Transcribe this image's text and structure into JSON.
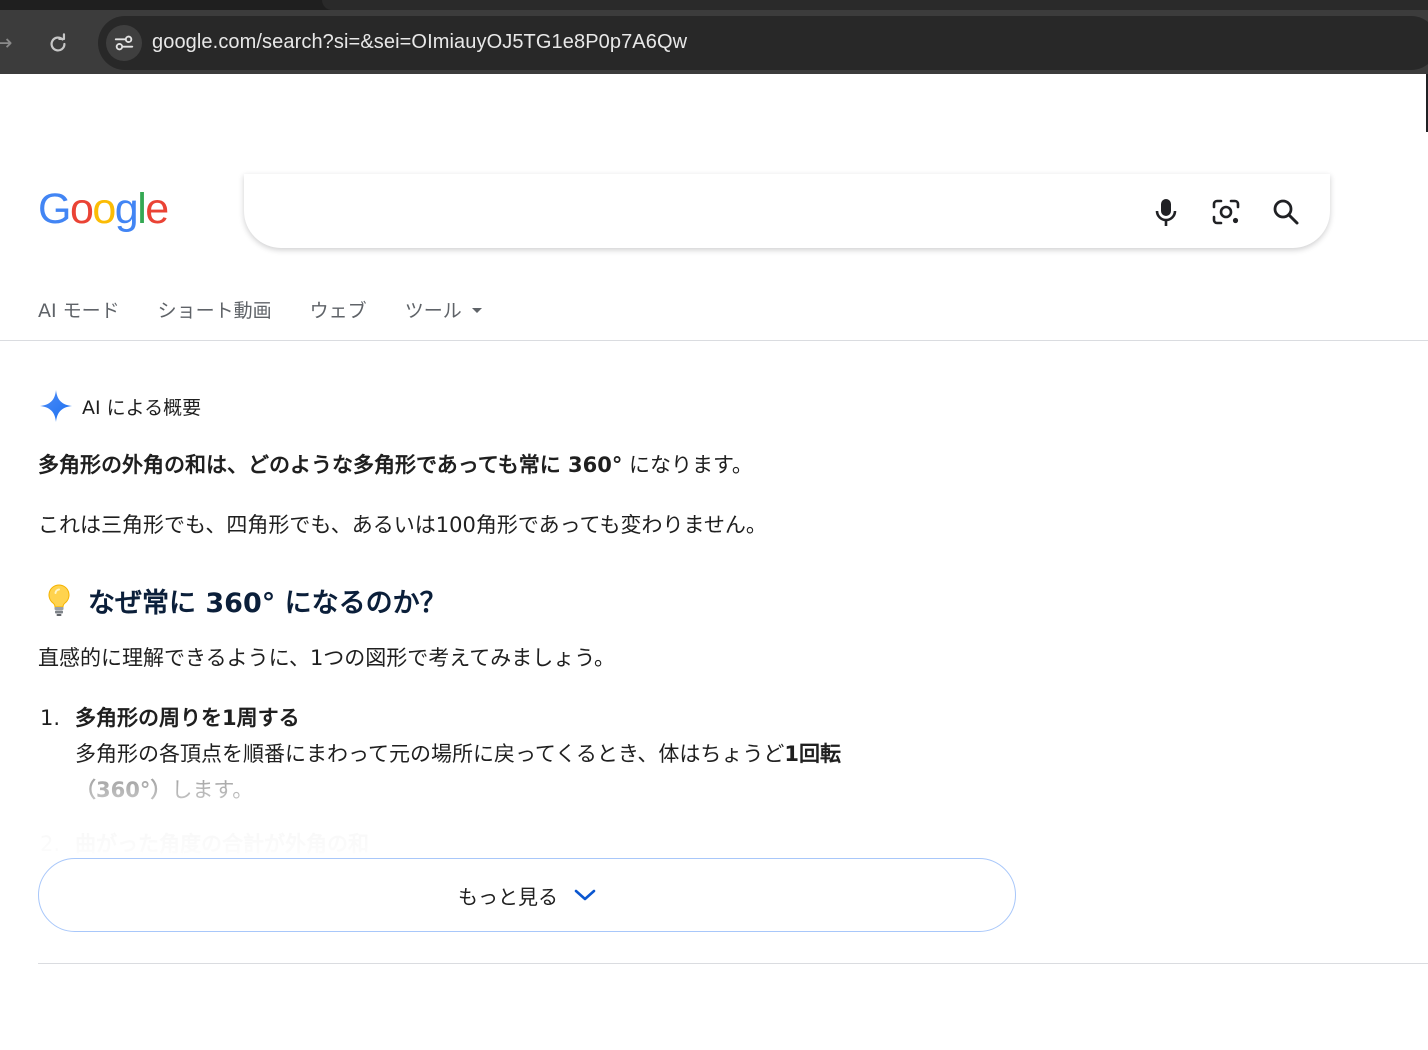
{
  "browser": {
    "url": "google.com/search?si=&sei=OImiauyOJ5TG1e8P0p7A6Qw"
  },
  "logo": {
    "letters": [
      "G",
      "o",
      "o",
      "g",
      "l",
      "e"
    ],
    "colors": [
      "#4285F4",
      "#EA4335",
      "#FBBC05",
      "#4285F4",
      "#34A853",
      "#EA4335"
    ]
  },
  "search": {
    "value": "",
    "icons": [
      "mic-icon",
      "lens-icon",
      "search-icon"
    ]
  },
  "tabs": [
    "AI モード",
    "ショート動画",
    "ウェブ",
    "ツール"
  ],
  "ai_overview": {
    "label": "AI による概要",
    "lead_bold": "多角形の外角の和は、どのような多角形であっても常に 360°",
    "lead_rest": " になります。",
    "para2": "これは三角形でも、四角形でも、あるいは100角形であっても変わりません。",
    "heading": "なぜ常に 360° になるのか？",
    "para3": "直感的に理解できるように、1つの図形で考えてみましょう。",
    "list": [
      {
        "num": "1.",
        "title": "多角形の周りを1周する",
        "body_line1_pre": "多角形の各頂点を順番にまわって元の場所に戻ってくるとき、体はちょうど",
        "body_line1_bold": "1回転",
        "body_line2_bold": "（360°）",
        "body_line2_rest": "します。"
      },
      {
        "num": "2.",
        "title": "曲がった角度の合計が外角の和"
      }
    ],
    "more_label": "もっと見る"
  }
}
